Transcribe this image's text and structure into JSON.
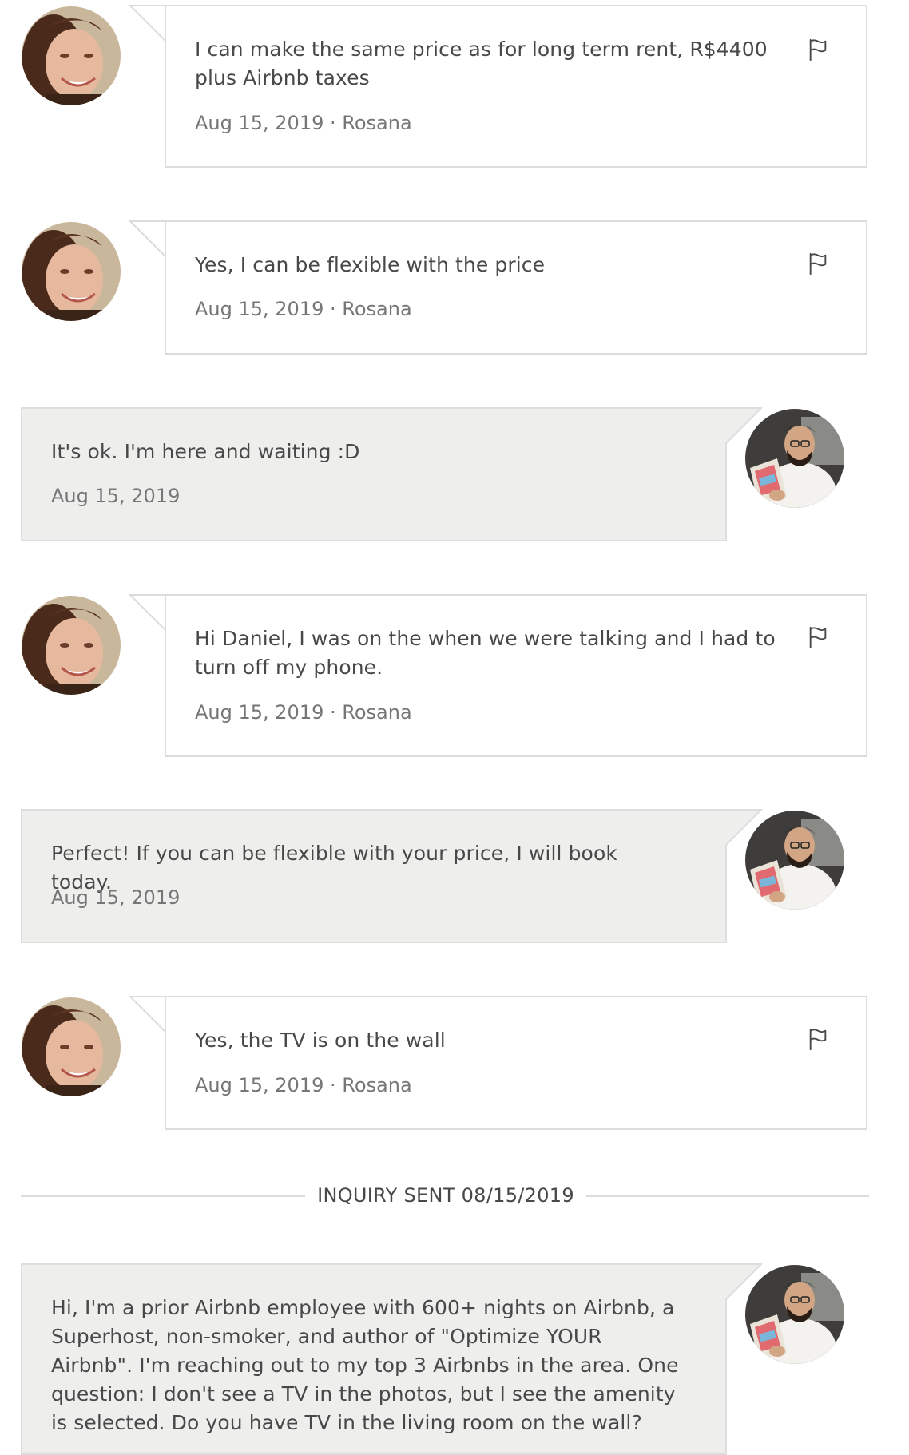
{
  "thread": {
    "messages": [
      {
        "sender": "host",
        "text": "I can make the same price as for long term rent, R$4400 plus Airbnb taxes",
        "meta": "Aug 15, 2019 · Rosana"
      },
      {
        "sender": "host",
        "text": "Yes, I can be flexible with the price",
        "meta": "Aug 15, 2019 · Rosana"
      },
      {
        "sender": "guest",
        "text": "It's ok. I'm here and waiting :D",
        "meta": "Aug 15, 2019"
      },
      {
        "sender": "host",
        "text": "Hi Daniel, I was on the when we were talking and I had to turn off my phone.",
        "meta": "Aug 15, 2019 · Rosana"
      },
      {
        "sender": "guest",
        "text": "Perfect! If you can be flexible with your price, I will book today.",
        "meta": "Aug 15, 2019"
      },
      {
        "sender": "host",
        "text": "Yes, the TV is on the wall",
        "meta": "Aug 15, 2019 · Rosana"
      },
      {
        "sender": "guest",
        "text": "Hi, I'm a prior Airbnb employee with 600+ nights on Airbnb, a Superhost, non-smoker, and author of \"Optimize YOUR Airbnb\". I'm reaching out to my top 3 Airbnbs in the area. One question: I don't see a TV in the photos, but I see the amenity is selected. Do you have TV in the living room on the wall?",
        "meta": ""
      }
    ],
    "divider_label": "INQUIRY SENT 08/15/2019"
  },
  "icons": {
    "flag": "flag-icon",
    "host_avatar": "host-avatar",
    "guest_avatar": "guest-avatar"
  },
  "colors": {
    "host_bubble_bg": "#ffffff",
    "guest_bubble_bg": "#eeefed",
    "border": "#dcdcdc",
    "text": "#484848",
    "meta": "#767676"
  }
}
